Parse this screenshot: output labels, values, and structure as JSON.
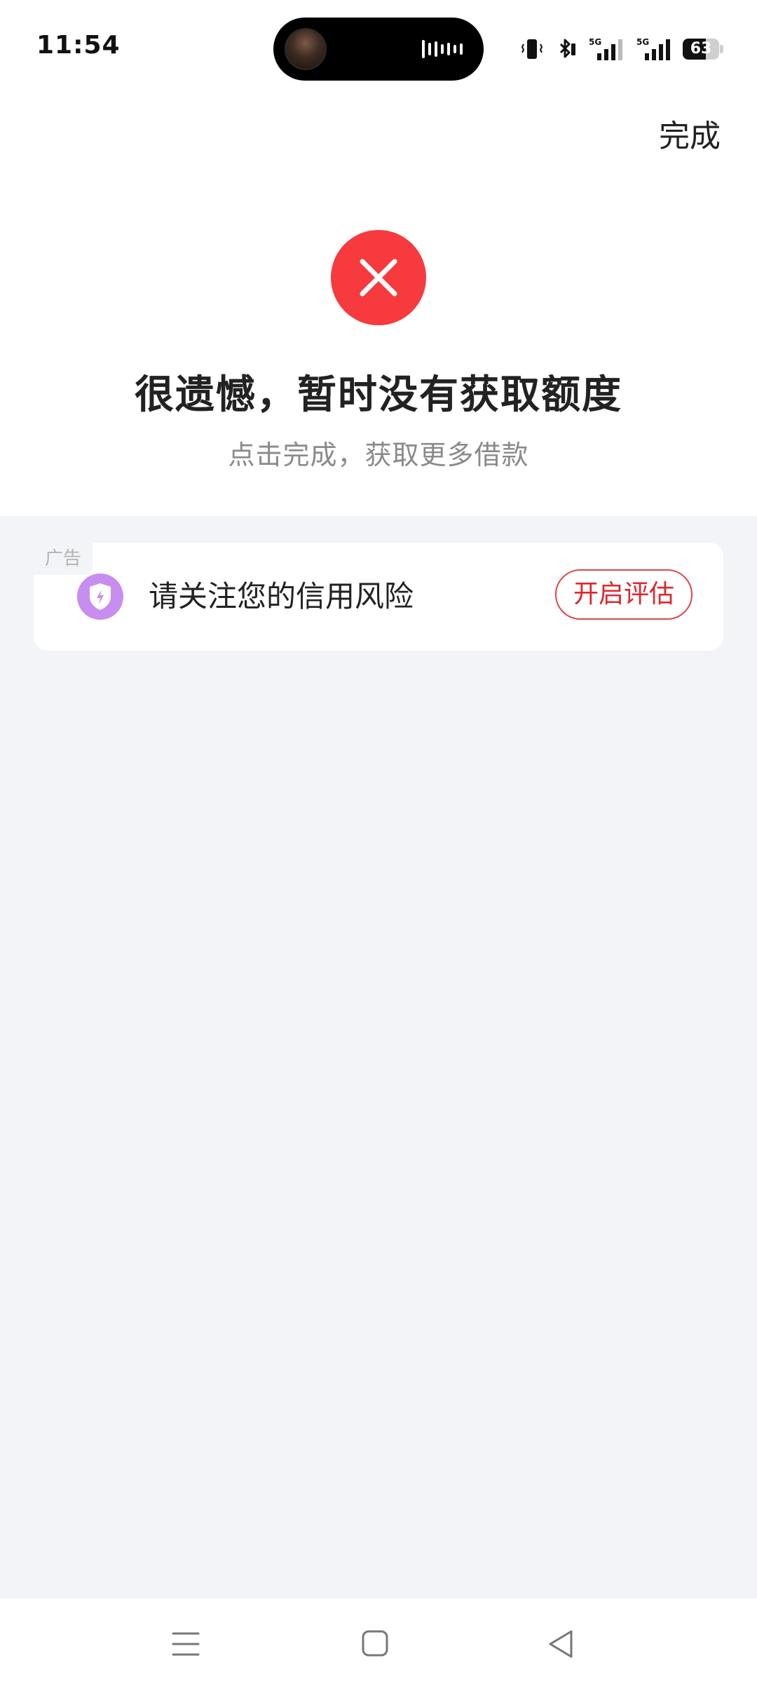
{
  "status_bar": {
    "time": "11:54",
    "battery_level": "63",
    "battery_fraction": 0.63,
    "network": [
      "5G",
      "5G"
    ],
    "icons": [
      "vibrate-icon",
      "bluetooth-icon",
      "signal-5g-icon",
      "signal-5g-icon",
      "battery-icon"
    ]
  },
  "header": {
    "done_label": "完成"
  },
  "result": {
    "icon": "error-close-icon",
    "icon_color": "#f63a3e",
    "title": "很遗憾，暂时没有获取额度",
    "subtitle": "点击完成，获取更多借款"
  },
  "ad_card": {
    "tag": "广告",
    "icon": "shield-icon",
    "icon_color": "#c78ef0",
    "text": "请关注您的信用风险",
    "button_label": "开启评估",
    "button_color": "#e0262d"
  },
  "nav_bar": {
    "buttons": [
      "menu-icon",
      "home-icon",
      "back-icon"
    ]
  },
  "colors": {
    "background": "#ffffff",
    "content_background": "#f3f4f8",
    "accent_red": "#f63a3e"
  }
}
